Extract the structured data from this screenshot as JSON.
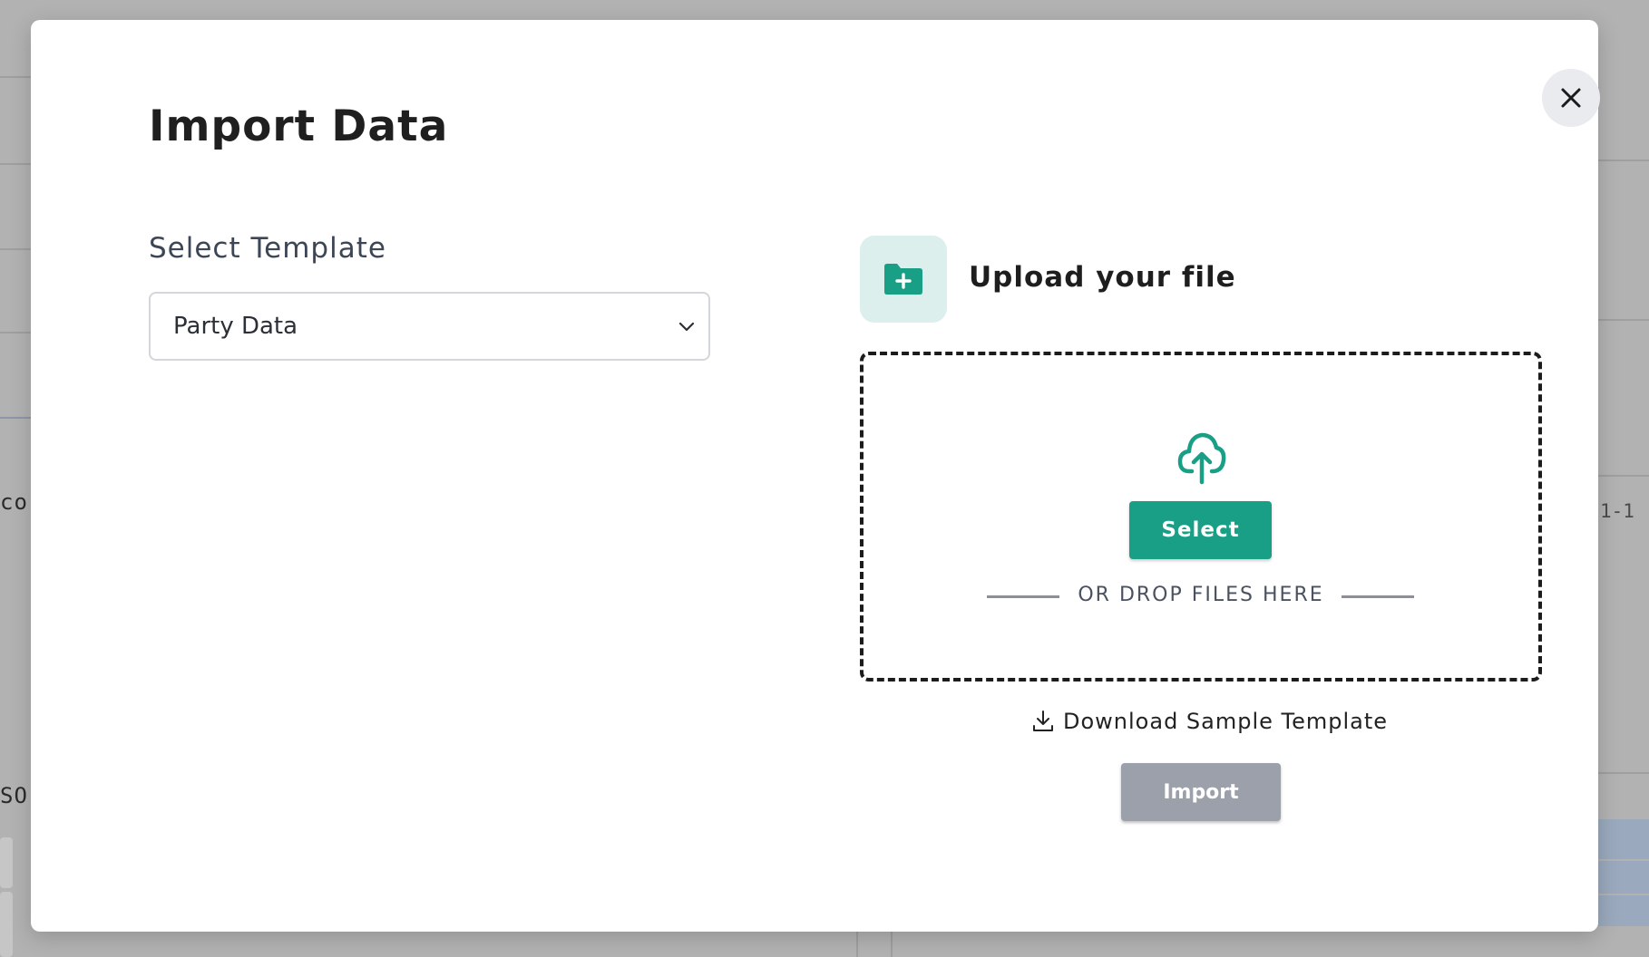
{
  "modal": {
    "title": "Import Data",
    "close_label": "×"
  },
  "template": {
    "label": "Select Template",
    "selected": "Party Data"
  },
  "upload": {
    "title": "Upload your file",
    "select_label": "Select",
    "drop_text": "OR DROP FILES HERE",
    "download_label": "Download Sample Template",
    "import_label": "Import"
  },
  "background": {
    "left_text_1": "cor",
    "left_text_2": "SO",
    "right_text": "1-1"
  },
  "colors": {
    "accent": "#1a9f87",
    "accent_light": "#dcefec",
    "disabled": "#9ba0aa"
  }
}
